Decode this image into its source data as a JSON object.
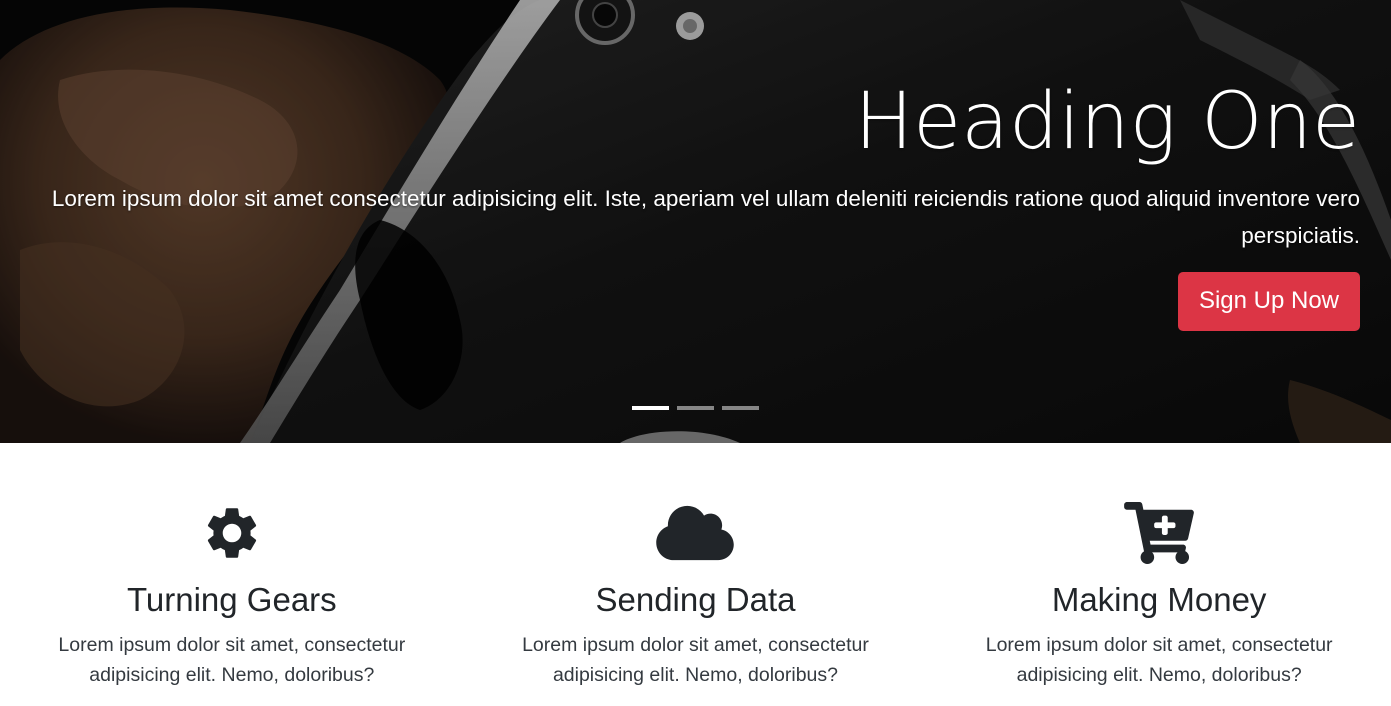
{
  "hero": {
    "heading": "Heading One",
    "text": "Lorem ipsum dolor sit amet consectetur adipisicing elit. Iste, aperiam vel ullam deleniti reiciendis ratione quod aliquid inventore vero perspiciatis.",
    "button_label": "Sign Up Now",
    "accent_color": "#dc3545",
    "slides_total": 3,
    "active_slide": 1
  },
  "features": [
    {
      "icon": "gear-icon",
      "title": "Turning Gears",
      "text": "Lorem ipsum dolor sit amet, consectetur adipisicing elit. Nemo, doloribus?"
    },
    {
      "icon": "cloud-icon",
      "title": "Sending Data",
      "text": "Lorem ipsum dolor sit amet, consectetur adipisicing elit. Nemo, doloribus?"
    },
    {
      "icon": "cart-plus-icon",
      "title": "Making Money",
      "text": "Lorem ipsum dolor sit amet, consectetur adipisicing elit. Nemo, doloribus?"
    }
  ]
}
